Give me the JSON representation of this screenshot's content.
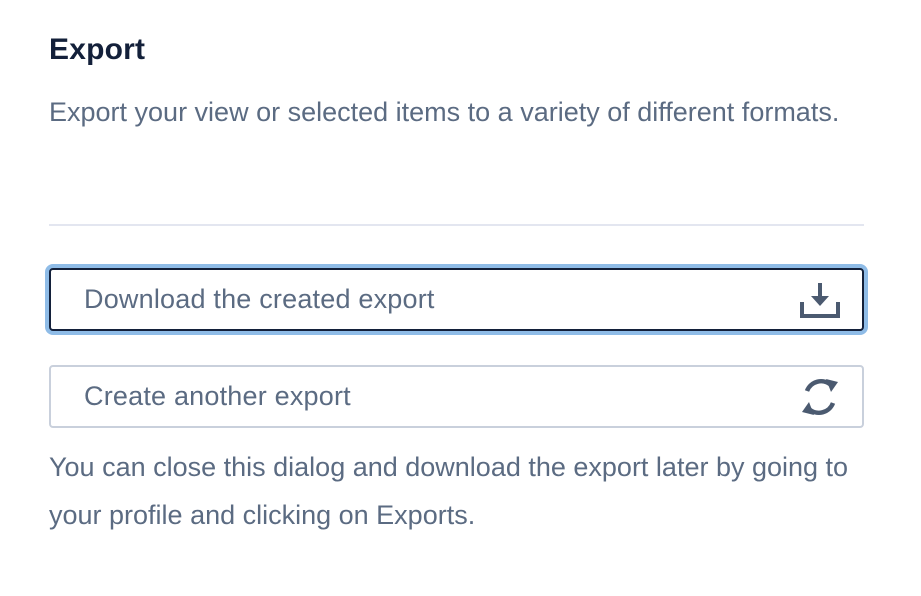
{
  "export_panel": {
    "title": "Export",
    "description": "Export your view or selected items to a variety of different formats.",
    "actions": [
      {
        "label": "Download the created export",
        "icon": "download-tray-icon"
      },
      {
        "label": "Create another export",
        "icon": "refresh-icon"
      }
    ],
    "note": "You can close this dialog and download the export later by going to your profile and clicking on Exports."
  },
  "colors": {
    "title": "#13203a",
    "body_text": "#5b6b82",
    "focus_ring": "#8fbce7",
    "focused_border": "#13203a",
    "default_border": "#c9d0dc",
    "divider": "#e3e6f0",
    "icon": "#4b5a70"
  }
}
